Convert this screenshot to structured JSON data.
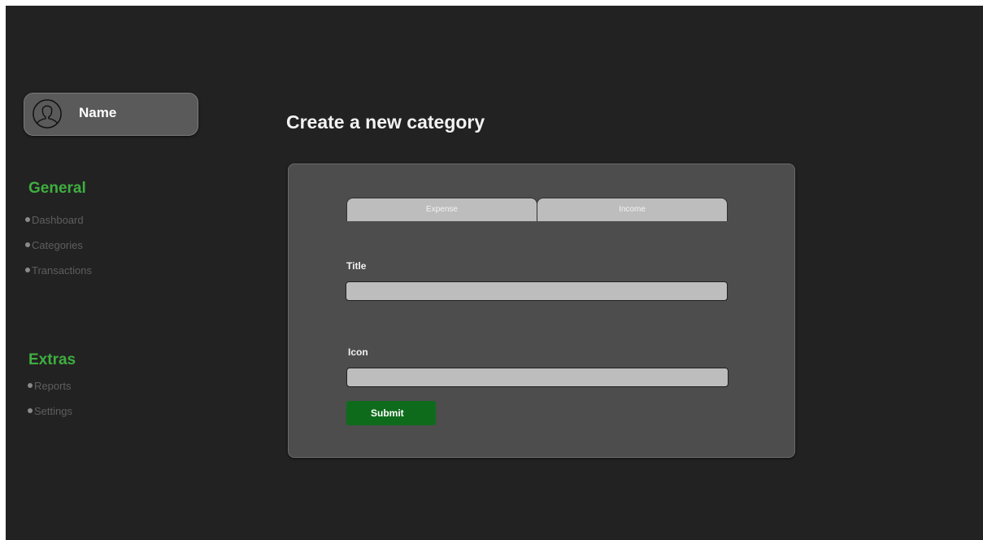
{
  "user": {
    "name": "Name",
    "avatar_icon": "user-outline-icon"
  },
  "sidebar": {
    "sections": [
      {
        "heading": "General",
        "items": [
          "Dashboard",
          "Categories",
          "Transactions"
        ]
      },
      {
        "heading": "Extras",
        "items": [
          "Reports",
          "Settings"
        ]
      }
    ]
  },
  "page": {
    "title": "Create a new category"
  },
  "form": {
    "tabs": [
      {
        "label": "Expense"
      },
      {
        "label": "Income"
      }
    ],
    "title_label": "Title",
    "title_value": "",
    "icon_label": "Icon",
    "icon_value": "",
    "submit_label": "Submit"
  },
  "colors": {
    "background": "#222222",
    "accent": "#3fae3f",
    "panel": "#4d4d4d",
    "button": "#0e6b1c"
  }
}
